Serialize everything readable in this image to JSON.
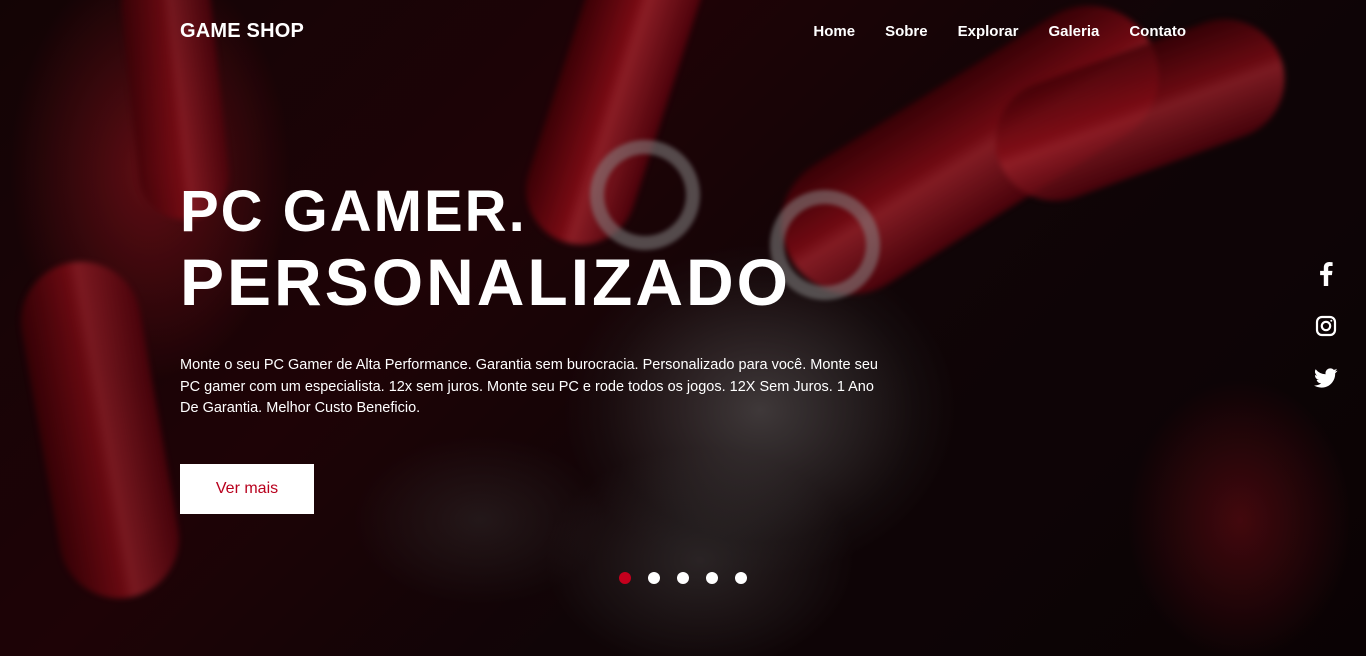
{
  "brand": {
    "logo": "GAME SHOP"
  },
  "nav": {
    "items": [
      {
        "label": "Home"
      },
      {
        "label": "Sobre"
      },
      {
        "label": "Explorar"
      },
      {
        "label": "Galeria"
      },
      {
        "label": "Contato"
      }
    ]
  },
  "hero": {
    "title_line1": "PC GAMER.",
    "title_line2": "PERSONALIZADO",
    "description": "Monte o seu PC Gamer de Alta Performance. Garantia sem burocracia. Personalizado para você. Monte seu PC gamer com um especialista. 12x sem juros. Monte seu PC e rode todos os jogos. 12X Sem Juros. 1 Ano De Garantia. Melhor Custo Beneficio.",
    "cta_label": "Ver mais"
  },
  "slider": {
    "total": 5,
    "active_index": 0
  },
  "social": {
    "icons": [
      "facebook-icon",
      "instagram-icon",
      "twitter-icon"
    ]
  },
  "colors": {
    "accent": "#c4001d",
    "cta_text": "#b8001d",
    "text": "#ffffff"
  }
}
